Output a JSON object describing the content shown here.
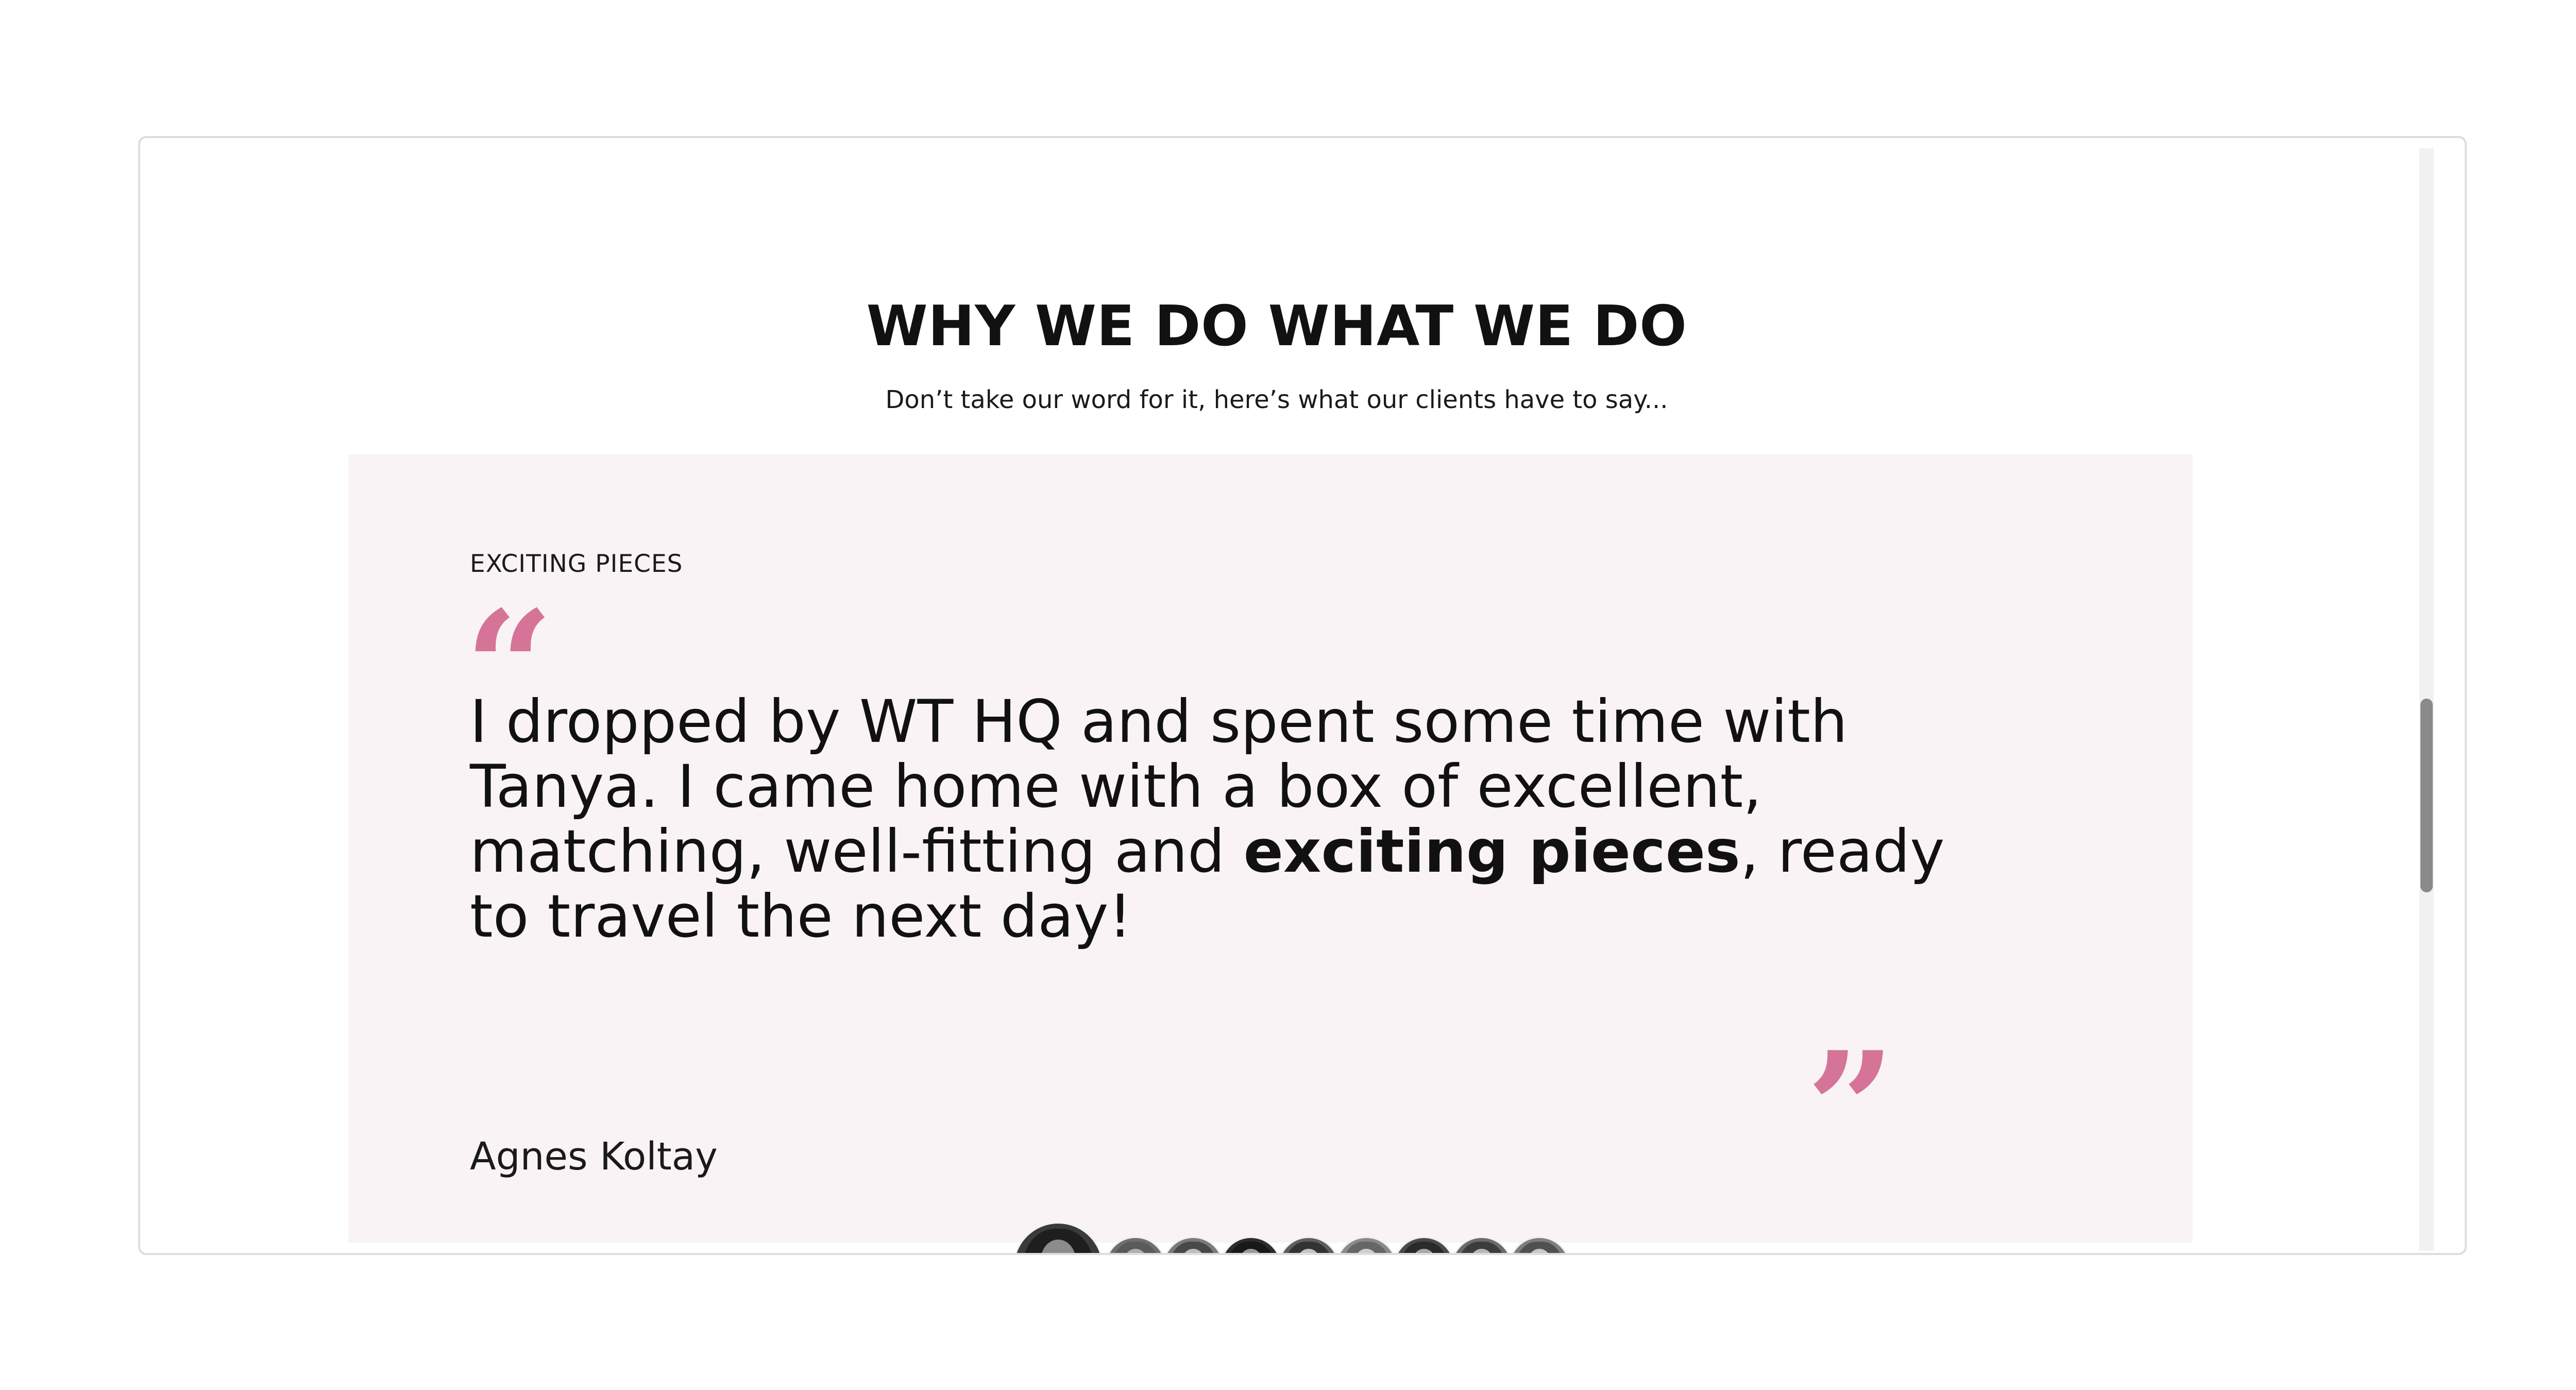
{
  "section": {
    "title": "WHY WE DO WHAT WE DO",
    "subtitle": "Don’t take our word for it, here’s what our clients have to say..."
  },
  "testimonial": {
    "eyebrow": "EXCITING PIECES",
    "quote_open_glyph": "“",
    "quote_close_glyph": "”",
    "quote_parts": {
      "lead": "I dropped by WT HQ and spent some time with Tanya. I came home with a box of excellent, matching, well-fitting and ",
      "highlight": "exciting pieces",
      "tail": ", ready to travel the next day!"
    },
    "author": "Agnes Koltay"
  },
  "avatars": {
    "active_index": 0,
    "count": 9
  },
  "colors": {
    "accent": "#d57496",
    "card_background": "#f9f3f5",
    "text": "#111111"
  }
}
